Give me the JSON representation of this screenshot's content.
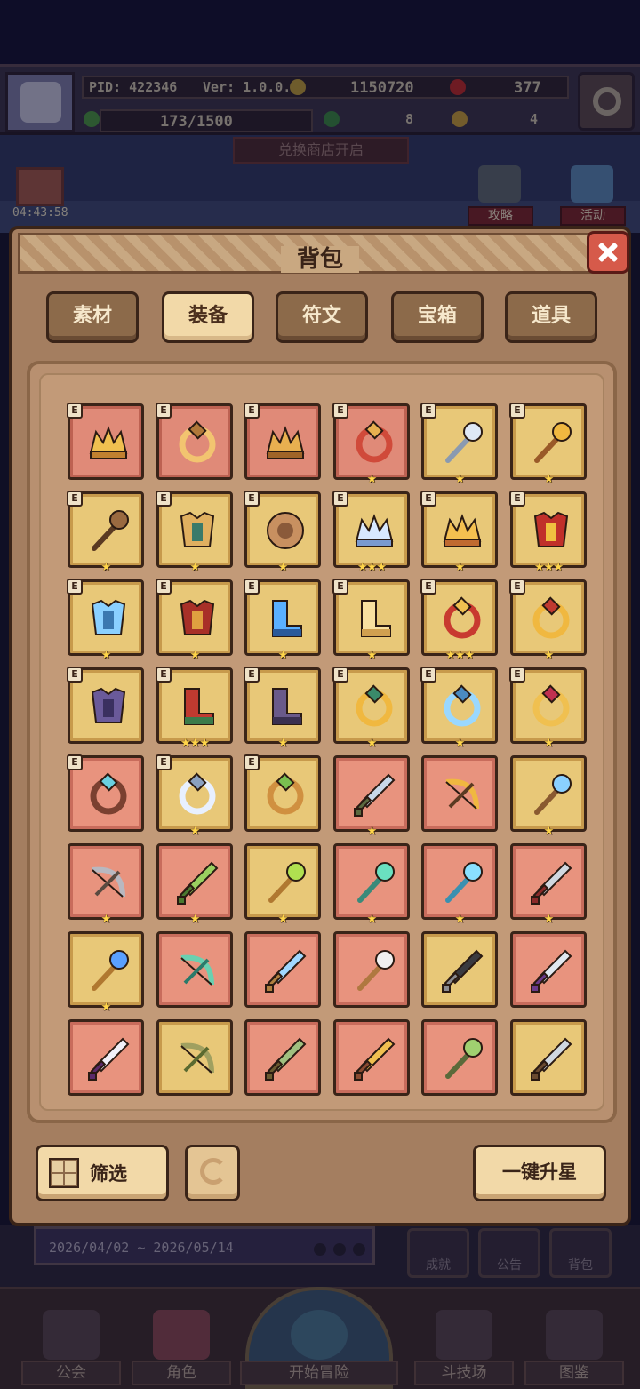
{
  "hud": {
    "pid": "PID: 422346",
    "version": "Ver: 1.0.0.9",
    "gold": "1150720",
    "gems": "377",
    "stamina": "173/1500",
    "clover": "8",
    "key": "4",
    "exchange_notice": "兑换商店开启",
    "timer": "04:43:58",
    "side_buttons": [
      "攻略",
      "活动"
    ]
  },
  "modal": {
    "title": "背包",
    "tabs": [
      "素材",
      "装备",
      "符文",
      "宝箱",
      "道具"
    ],
    "active_tab": "装备",
    "filter_label": "筛选",
    "upgrade_all_label": "一键升星"
  },
  "items": [
    {
      "row": 0,
      "col": 0,
      "bg": "red",
      "badge": "E",
      "stars": 0,
      "icon": "straw-hat-icon",
      "c1": "#f0c050",
      "c2": "#c08030"
    },
    {
      "row": 0,
      "col": 1,
      "bg": "red",
      "badge": "E",
      "stars": 0,
      "icon": "ring-icon",
      "c1": "#f2c470",
      "c2": "#b0783a"
    },
    {
      "row": 0,
      "col": 2,
      "bg": "red",
      "badge": "E",
      "stars": 0,
      "icon": "horned-helmet-icon",
      "c1": "#e8b050",
      "c2": "#a06428"
    },
    {
      "row": 0,
      "col": 3,
      "bg": "red",
      "badge": "E",
      "stars": 1,
      "icon": "red-gem-ring-icon",
      "c1": "#d04a3a",
      "c2": "#e8b050"
    },
    {
      "row": 0,
      "col": 4,
      "bg": "gold",
      "badge": "E",
      "stars": 1,
      "icon": "crystal-wand-icon",
      "c1": "#dfe8f5",
      "c2": "#8a9ab0"
    },
    {
      "row": 0,
      "col": 5,
      "bg": "gold",
      "badge": "E",
      "stars": 1,
      "icon": "golden-scepter-icon",
      "c1": "#f0b840",
      "c2": "#9a5a28"
    },
    {
      "row": 1,
      "col": 0,
      "bg": "gold",
      "badge": "E",
      "stars": 1,
      "icon": "wooden-club-icon",
      "c1": "#9a6a40",
      "c2": "#5a3a22"
    },
    {
      "row": 1,
      "col": 1,
      "bg": "gold",
      "badge": "E",
      "stars": 1,
      "icon": "leather-armor-icon",
      "c1": "#e0b060",
      "c2": "#3a7a6a"
    },
    {
      "row": 1,
      "col": 2,
      "bg": "gold",
      "badge": "E",
      "stars": 1,
      "icon": "round-shield-icon",
      "c1": "#c89060",
      "c2": "#8a5a3a"
    },
    {
      "row": 1,
      "col": 3,
      "bg": "gold",
      "badge": "E",
      "stars": 3,
      "icon": "ice-crystal-crown-icon",
      "c1": "#d8e8ff",
      "c2": "#7a9ad0"
    },
    {
      "row": 1,
      "col": 4,
      "bg": "gold",
      "badge": "E",
      "stars": 1,
      "icon": "golden-crown-icon",
      "c1": "#f4c050",
      "c2": "#c06a30"
    },
    {
      "row": 1,
      "col": 5,
      "bg": "gold",
      "badge": "E",
      "stars": 3,
      "icon": "royal-cape-icon",
      "c1": "#c0302a",
      "c2": "#f0c040"
    },
    {
      "row": 2,
      "col": 0,
      "bg": "gold",
      "badge": "E",
      "stars": 1,
      "icon": "ice-armor-icon",
      "c1": "#8ad0ff",
      "c2": "#3a78b0"
    },
    {
      "row": 2,
      "col": 1,
      "bg": "gold",
      "badge": "E",
      "stars": 1,
      "icon": "crimson-armor-icon",
      "c1": "#a83028",
      "c2": "#e0a040"
    },
    {
      "row": 2,
      "col": 2,
      "bg": "gold",
      "badge": "E",
      "stars": 1,
      "icon": "ice-boots-icon",
      "c1": "#5ab0ff",
      "c2": "#2a5a9a"
    },
    {
      "row": 2,
      "col": 3,
      "bg": "gold",
      "badge": "E",
      "stars": 1,
      "icon": "golden-boots-icon",
      "c1": "#f8e0a0",
      "c2": "#d0a050"
    },
    {
      "row": 2,
      "col": 4,
      "bg": "gold",
      "badge": "E",
      "stars": 3,
      "icon": "ruby-amulet-icon",
      "c1": "#c83a30",
      "c2": "#f0c050"
    },
    {
      "row": 2,
      "col": 5,
      "bg": "gold",
      "badge": "E",
      "stars": 1,
      "icon": "golden-necklace-icon",
      "c1": "#f0b840",
      "c2": "#c03a30"
    },
    {
      "row": 3,
      "col": 0,
      "bg": "gold",
      "badge": "E",
      "stars": 0,
      "icon": "shadow-pauldron-icon",
      "c1": "#6a5a9a",
      "c2": "#3a3060"
    },
    {
      "row": 3,
      "col": 1,
      "bg": "gold",
      "badge": "E",
      "stars": 3,
      "icon": "jester-boots-icon",
      "c1": "#c03a30",
      "c2": "#3a7a4a"
    },
    {
      "row": 3,
      "col": 2,
      "bg": "gold",
      "badge": "E",
      "stars": 1,
      "icon": "dark-boots-icon",
      "c1": "#6a5a8a",
      "c2": "#3a3050"
    },
    {
      "row": 3,
      "col": 3,
      "bg": "gold",
      "badge": "E",
      "stars": 1,
      "icon": "jeweled-brooch-icon",
      "c1": "#f0b840",
      "c2": "#3a8a6a"
    },
    {
      "row": 3,
      "col": 4,
      "bg": "gold",
      "badge": "E",
      "stars": 1,
      "icon": "frost-gem-icon",
      "c1": "#9ad8ff",
      "c2": "#4a8ac0"
    },
    {
      "row": 3,
      "col": 5,
      "bg": "gold",
      "badge": "E",
      "stars": 1,
      "icon": "heart-necklace-icon",
      "c1": "#f0c050",
      "c2": "#c03050"
    },
    {
      "row": 4,
      "col": 0,
      "bg": "pink",
      "badge": "E",
      "stars": 0,
      "icon": "diamond-pendant-icon",
      "c1": "#7a4030",
      "c2": "#6ad0e0"
    },
    {
      "row": 4,
      "col": 1,
      "bg": "gold",
      "badge": "E",
      "stars": 1,
      "icon": "silver-ring-icon",
      "c1": "#e8f0ff",
      "c2": "#8aa0c0"
    },
    {
      "row": 4,
      "col": 2,
      "bg": "gold",
      "badge": "E",
      "stars": 0,
      "icon": "emerald-ring-icon",
      "c1": "#d09040",
      "c2": "#7ac050"
    },
    {
      "row": 4,
      "col": 3,
      "bg": "pink",
      "badge": "",
      "stars": 1,
      "icon": "crossed-swords-icon",
      "c1": "#c8d8e8",
      "c2": "#5a6a40"
    },
    {
      "row": 4,
      "col": 4,
      "bg": "pink",
      "badge": "",
      "stars": 0,
      "icon": "crossbow-icon",
      "c1": "#f0b840",
      "c2": "#5a3a22"
    },
    {
      "row": 4,
      "col": 5,
      "bg": "gold",
      "badge": "",
      "stars": 1,
      "icon": "sapphire-staff-icon",
      "c1": "#8ad0ff",
      "c2": "#8a5a30"
    },
    {
      "row": 5,
      "col": 0,
      "bg": "pink",
      "badge": "",
      "stars": 1,
      "icon": "steel-crossbow-icon",
      "c1": "#b8b8c0",
      "c2": "#5a4a40"
    },
    {
      "row": 5,
      "col": 1,
      "bg": "pink",
      "badge": "",
      "stars": 1,
      "icon": "leaf-blade-icon",
      "c1": "#9ad060",
      "c2": "#4a7a30"
    },
    {
      "row": 5,
      "col": 2,
      "bg": "gold",
      "badge": "",
      "stars": 1,
      "icon": "emerald-scepter-icon",
      "c1": "#b0e050",
      "c2": "#b07830"
    },
    {
      "row": 5,
      "col": 3,
      "bg": "pink",
      "badge": "",
      "stars": 1,
      "icon": "jade-staff-icon",
      "c1": "#6ae0c0",
      "c2": "#3a8a7a"
    },
    {
      "row": 5,
      "col": 4,
      "bg": "pink",
      "badge": "",
      "stars": 1,
      "icon": "ice-rod-icon",
      "c1": "#8ae0ff",
      "c2": "#3a90b0"
    },
    {
      "row": 5,
      "col": 5,
      "bg": "pink",
      "badge": "",
      "stars": 1,
      "icon": "dark-blade-icon",
      "c1": "#d0d8e0",
      "c2": "#8a2a2a"
    },
    {
      "row": 6,
      "col": 0,
      "bg": "gold",
      "badge": "",
      "stars": 1,
      "icon": "blue-orb-staff-icon",
      "c1": "#5aa0ff",
      "c2": "#b07830"
    },
    {
      "row": 6,
      "col": 1,
      "bg": "pink",
      "badge": "",
      "stars": 0,
      "icon": "jade-bow-icon",
      "c1": "#6ad0b0",
      "c2": "#2a7a6a"
    },
    {
      "row": 6,
      "col": 2,
      "bg": "pink",
      "badge": "",
      "stars": 0,
      "icon": "azure-dagger-icon",
      "c1": "#a0d8ff",
      "c2": "#b08040"
    },
    {
      "row": 6,
      "col": 3,
      "bg": "pink",
      "badge": "",
      "stars": 0,
      "icon": "bone-wand-icon",
      "c1": "#f0f0f0",
      "c2": "#b07840"
    },
    {
      "row": 6,
      "col": 4,
      "bg": "gold",
      "badge": "",
      "stars": 0,
      "icon": "obsidian-sword-icon",
      "c1": "#3a3a40",
      "c2": "#8a8a90"
    },
    {
      "row": 6,
      "col": 5,
      "bg": "pink",
      "badge": "",
      "stars": 0,
      "icon": "amethyst-sword-icon",
      "c1": "#e0e8f0",
      "c2": "#6a3a8a"
    },
    {
      "row": 7,
      "col": 0,
      "bg": "pink",
      "badge": "",
      "stars": 0,
      "icon": "violet-dagger-icon",
      "c1": "#f0f0f8",
      "c2": "#5a2a6a"
    },
    {
      "row": 7,
      "col": 1,
      "bg": "gold",
      "badge": "",
      "stars": 0,
      "icon": "vine-bow-icon",
      "c1": "#a0a060",
      "c2": "#5a6a30"
    },
    {
      "row": 7,
      "col": 2,
      "bg": "pink",
      "badge": "",
      "stars": 0,
      "icon": "bronze-sword-icon",
      "c1": "#a0c080",
      "c2": "#6a5a30"
    },
    {
      "row": 7,
      "col": 3,
      "bg": "pink",
      "badge": "",
      "stars": 0,
      "icon": "golden-spear-icon",
      "c1": "#f0c050",
      "c2": "#8a4a30"
    },
    {
      "row": 7,
      "col": 4,
      "bg": "pink",
      "badge": "",
      "stars": 0,
      "icon": "green-mace-icon",
      "c1": "#a0d070",
      "c2": "#5a6a3a"
    },
    {
      "row": 7,
      "col": 5,
      "bg": "gold",
      "badge": "",
      "stars": 0,
      "icon": "iron-sword-icon",
      "c1": "#d0d8e0",
      "c2": "#6a4a30"
    }
  ],
  "bottom": {
    "event_dates": "2026/04/02 ~ 2026/05/14",
    "small_menu": [
      "成就",
      "公告",
      "背包"
    ],
    "nav": [
      "公会",
      "角色",
      "开始冒险",
      "斗技场",
      "图鉴"
    ]
  },
  "colors": {
    "panel_bg": "#a47e60",
    "tab_active": "#f2d9a8",
    "slot_gold": "#e8c878",
    "slot_red": "#e08a78",
    "star": "#ffd54a",
    "close_red": "#d65a4a"
  }
}
